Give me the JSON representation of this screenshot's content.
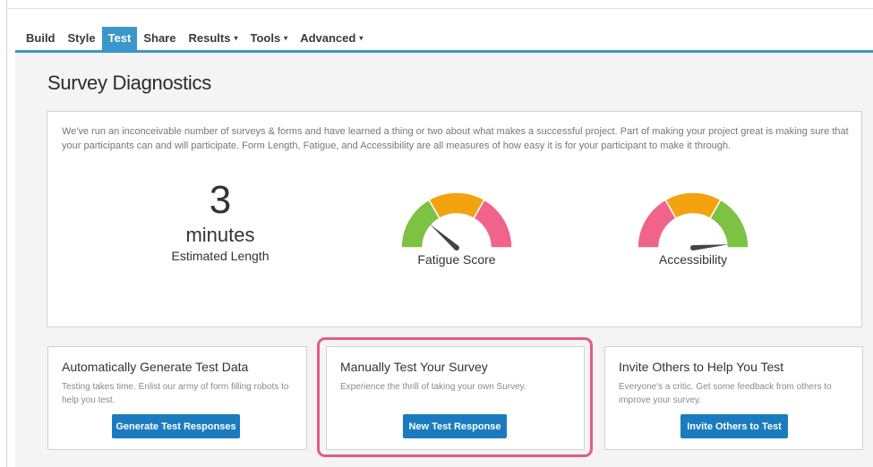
{
  "nav": {
    "items": [
      {
        "label": "Build",
        "caret": ""
      },
      {
        "label": "Style",
        "caret": ""
      },
      {
        "label": "Test",
        "caret": ""
      },
      {
        "label": "Share",
        "caret": ""
      },
      {
        "label": "Results",
        "caret": "▾"
      },
      {
        "label": "Tools",
        "caret": "▾"
      },
      {
        "label": "Advanced",
        "caret": "▾"
      }
    ],
    "active": "Test",
    "accent_color": "#3a97c9"
  },
  "page": {
    "title": "Survey Diagnostics"
  },
  "diagnostics": {
    "intro": "We've run an inconceivable number of surveys & forms and have learned a thing or two about what makes a successful project. Part of making your project great is making sure that your participants can and will participate. Form Length, Fatigue, and Accessibility are all measures of how easy it is for your participant to make it through.",
    "length": {
      "value": "3",
      "unit": "minutes",
      "label": "Estimated Length"
    },
    "fatigue": {
      "label": "Fatigue Score",
      "segment_colors": [
        "#7dc242",
        "#f2a30f",
        "#f0638a"
      ],
      "needle_level": 0.23
    },
    "accessibility": {
      "label": "Accessibility",
      "segment_colors": [
        "#f0638a",
        "#f2a30f",
        "#7dc242"
      ],
      "needle_level": 0.97
    }
  },
  "cards": [
    {
      "title": "Automatically Generate Test Data",
      "description": "Testing takes time. Enlist our army of form filling robots to help you test.",
      "button": "Generate Test Responses"
    },
    {
      "title": "Manually Test Your Survey",
      "description": "Experience the thrill of taking your own Survey.",
      "button": "New Test Response"
    },
    {
      "title": "Invite Others to Help You Test",
      "description": "Everyone's a critic. Get some feedback from others to improve your survey.",
      "button": "Invite Others to Test"
    }
  ],
  "colors": {
    "button": "#1a7bbf",
    "highlight": "#e25d87",
    "content_bg": "#f4f4f4"
  }
}
